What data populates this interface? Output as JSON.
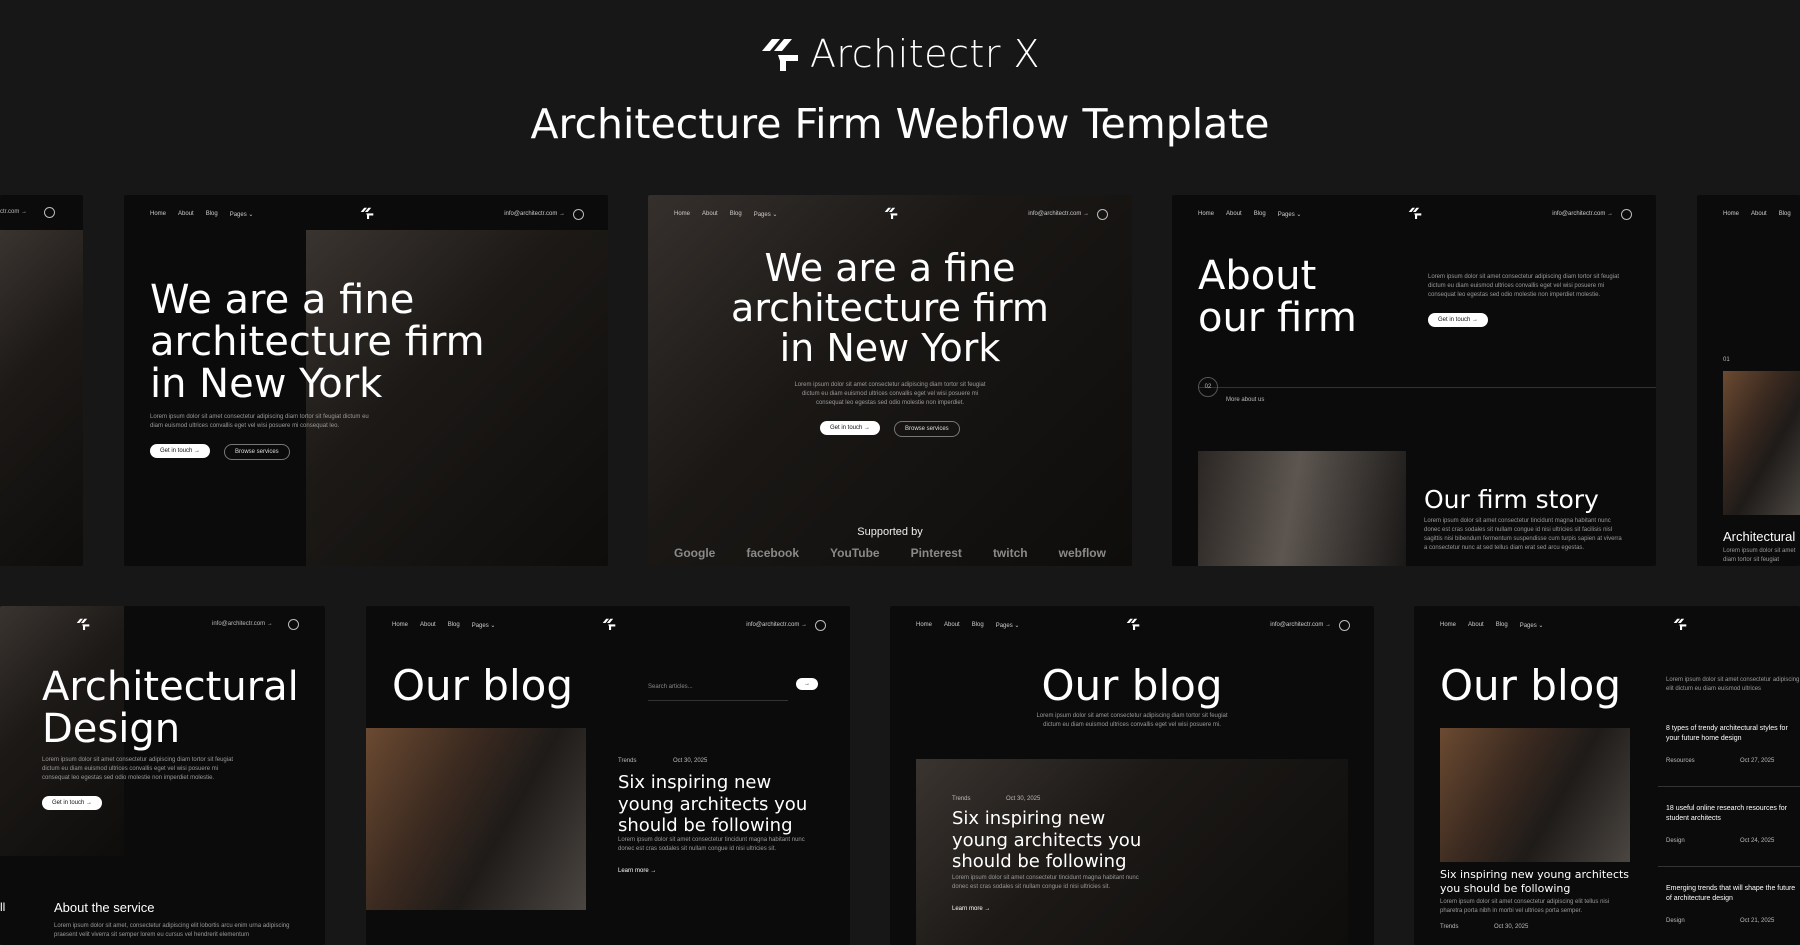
{
  "brand": {
    "name": "Architectr X"
  },
  "headline": "Architecture Firm Webflow Template",
  "nav": {
    "home": "Home",
    "about": "About",
    "blog": "Blog",
    "pages": "Pages ⌄",
    "email": "info@architectr.com →",
    "email_short": "ctr.com →"
  },
  "hero": {
    "title": "We are a fine architecture firm in New York",
    "lorem": "Lorem ipsum dolor sit amet consectetur adipiscing diam tortor sit feugiat dictum eu diam euismod ultrices convallis eget vel wisi posuere mi consequat leo.",
    "cta": "Get in touch →",
    "secondary": "Browse services"
  },
  "hero2": {
    "lorem": "Lorem ipsum dolor sit amet consectetur adipiscing diam tortor sit feugiat dictum eu diam euismod ultrices convallis eget vel wisi posuere mi consequat leo egestas sed odio molestie non imperdiet.",
    "supported": "Supported by",
    "logos": [
      "Google",
      "facebook",
      "YouTube",
      "Pinterest",
      "twitch",
      "webflow"
    ]
  },
  "about": {
    "title": "About our firm",
    "lorem": "Lorem ipsum dolor sit amet consectetur adipiscing diam tortor sit feugiat dictum eu diam euismod ultrices convallis eget vel wisi posuere mi consequat leo egestas sed odio molestie non imperdiet molestie.",
    "cta": "Get in touch →",
    "num": "02",
    "more": "More about us",
    "story": "Our firm story",
    "story_lorem": "Lorem ipsum dolor sit amet consectetur tincidunt magna habitant nunc donec est cras sodales sit nullam congue id nisi ultricies sit facilisis nisl sagittis nisi bibendum fermentum suspendisse cum turpis sapien at viverra a consectetur nunc at sed tellus diam erat sed arcu egestas."
  },
  "partial_right": {
    "num": "01",
    "title": "Architectural",
    "lorem": "Lorem ipsum dolor sit amet diam tortor sit feugiat"
  },
  "design": {
    "title": "Architectural Design",
    "lorem": "Lorem ipsum dolor sit amet consectetur adipiscing diam tortor sit feugiat dictum eu diam euismod ultrices convallis eget vel wisi posuere mi consequat leo egestas sed odio molestie non imperdiet molestie.",
    "cta": "Get in touch →",
    "service": "About the service",
    "service_lorem": "Lorem ipsum dolor sit amet, consectetur adipiscing elit lobortis arcu enim urna adipiscing praesent velit viverra sit semper lorem eu cursus vel hendrerit elementum",
    "edge": "ll"
  },
  "blog": {
    "title": "Our blog",
    "search": "Search articles...",
    "tag": "Trends",
    "date": "Oct 30, 2025",
    "post": "Six inspiring new young architects you should be following",
    "post_lorem": "Lorem ipsum dolor sit amet consectetur tincidunt magna habitant nunc donec est cras sodales sit nullam congue id nisi ultricies sit.",
    "more": "Learn more →",
    "intro": "Lorem ipsum dolor sit amet consectetur adipiscing diam tortor sit feugiat dictum eu diam euismod ultrices convallis eget vel wisi posuere mi."
  },
  "blog4": {
    "post": "Six inspiring new young architects you should be following",
    "lorem": "Lorem ipsum dolor sit amet consectetur adipiscing elit tellus nisi pharetra porta nibh in morbi vel ultrices porta semper.",
    "side": [
      {
        "title": "8 types of trendy architectural styles for your future home design",
        "tag": "Resources",
        "date": "Oct 27, 2025"
      },
      {
        "title": "18 useful online research resources for student architects",
        "tag": "Design",
        "date": "Oct 24, 2025"
      },
      {
        "title": "Emerging trends that will shape the future of architecture design",
        "tag": "Design",
        "date": "Oct 21, 2025"
      }
    ],
    "side_intro": "Lorem ipsum dolor sit amet consectetur adipiscing elit dictum eu diam euismod ultrices"
  },
  "colors": {
    "background": "#181717",
    "card": "#0b0b0b",
    "text": "#ffffff",
    "muted": "#9a9a9a"
  }
}
